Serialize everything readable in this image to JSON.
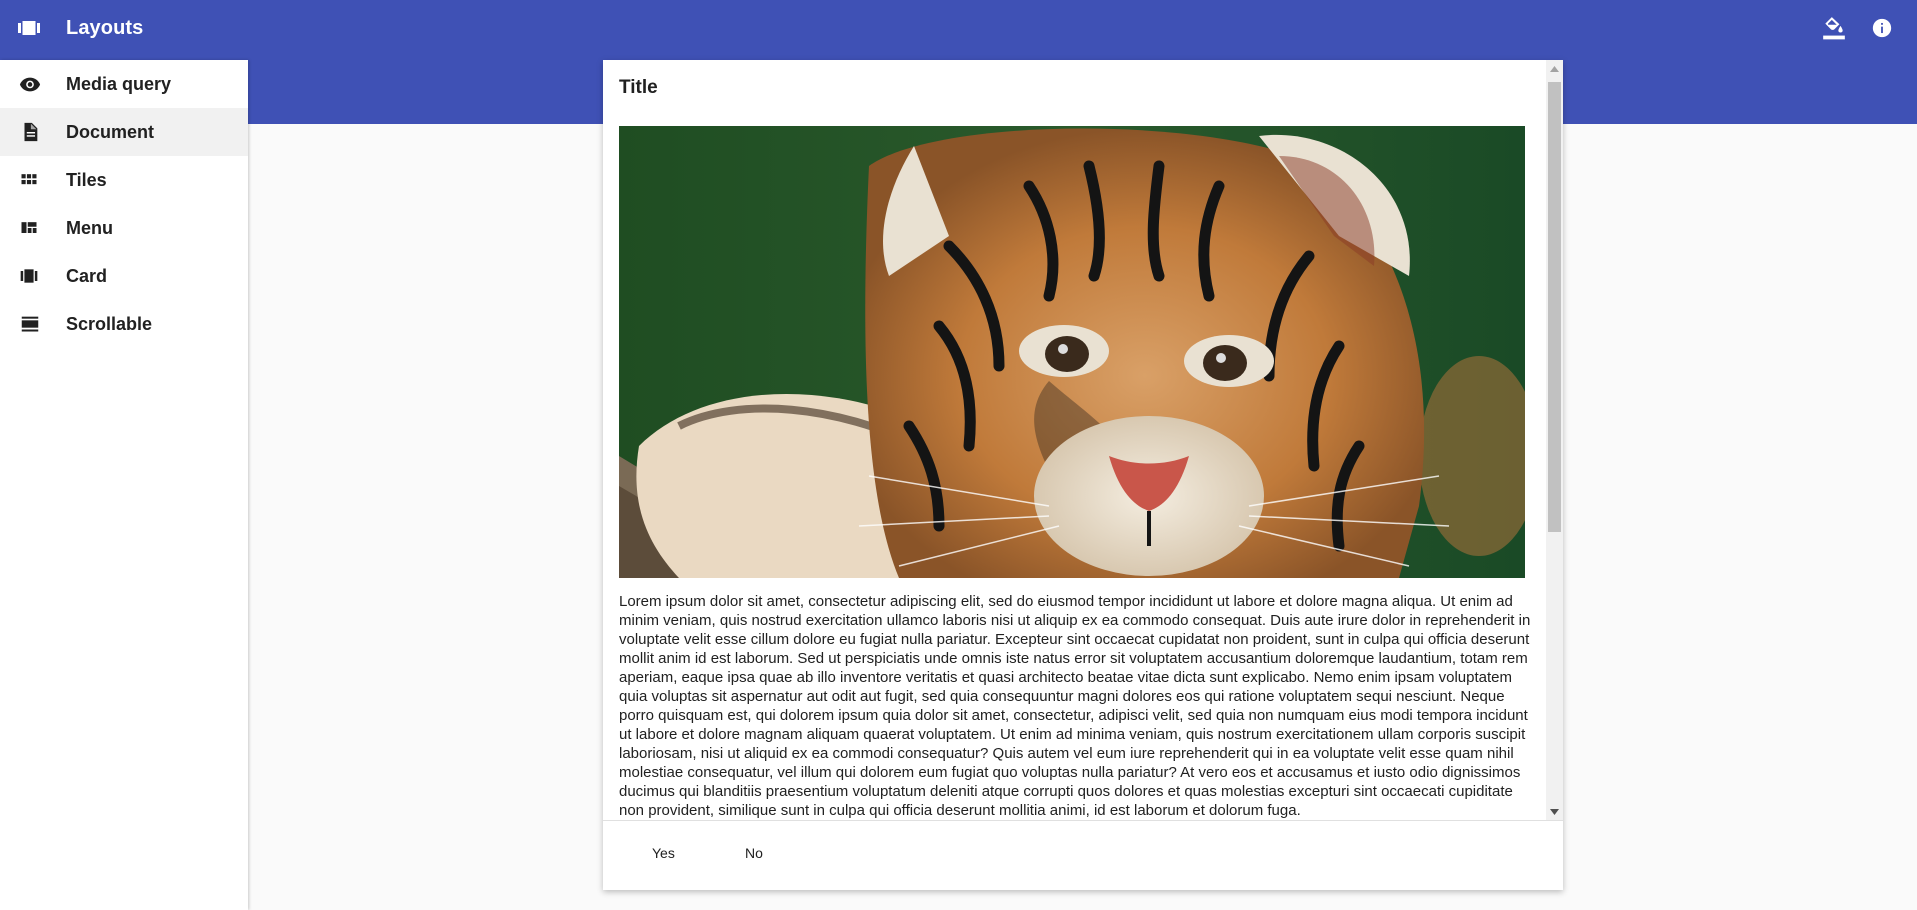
{
  "app": {
    "title": "Layouts"
  },
  "toolbar": {
    "actions": [
      {
        "icon": "paint-bucket-icon"
      },
      {
        "icon": "info-icon"
      }
    ]
  },
  "sidebar": {
    "items": [
      {
        "label": "Media query",
        "icon": "eye-icon",
        "active": false
      },
      {
        "label": "Document",
        "icon": "document-icon",
        "active": true
      },
      {
        "label": "Tiles",
        "icon": "grid-icon",
        "active": false
      },
      {
        "label": "Menu",
        "icon": "dashboard-icon",
        "active": false
      },
      {
        "label": "Card",
        "icon": "carousel-icon",
        "active": false
      },
      {
        "label": "Scrollable",
        "icon": "list-icon",
        "active": false
      }
    ]
  },
  "dialog": {
    "title": "Title",
    "image": {
      "subject": "tiger-cub-photo"
    },
    "body": "Lorem ipsum dolor sit amet, consectetur adipiscing elit, sed do eiusmod tempor incididunt ut labore et dolore magna aliqua. Ut enim ad minim veniam, quis nostrud exercitation ullamco laboris nisi ut aliquip ex ea commodo consequat. Duis aute irure dolor in reprehenderit in voluptate velit esse cillum dolore eu fugiat nulla pariatur. Excepteur sint occaecat cupidatat non proident, sunt in culpa qui officia deserunt mollit anim id est laborum. Sed ut perspiciatis unde omnis iste natus error sit voluptatem accusantium doloremque laudantium, totam rem aperiam, eaque ipsa quae ab illo inventore veritatis et quasi architecto beatae vitae dicta sunt explicabo. Nemo enim ipsam voluptatem quia voluptas sit aspernatur aut odit aut fugit, sed quia consequuntur magni dolores eos qui ratione voluptatem sequi nesciunt. Neque porro quisquam est, qui dolorem ipsum quia dolor sit amet, consectetur, adipisci velit, sed quia non numquam eius modi tempora incidunt ut labore et dolore magnam aliquam quaerat voluptatem. Ut enim ad minima veniam, quis nostrum exercitationem ullam corporis suscipit laboriosam, nisi ut aliquid ex ea commodi consequatur? Quis autem vel eum iure reprehenderit qui in ea voluptate velit esse quam nihil molestiae consequatur, vel illum qui dolorem eum fugiat quo voluptas nulla pariatur? At vero eos et accusamus et iusto odio dignissimos ducimus qui blanditiis praesentium voluptatum deleniti atque corrupti quos dolores et quas molestias excepturi sint occaecati cupiditate non provident, similique sunt in culpa qui officia deserunt mollitia animi, id est laborum et dolorum fuga.",
    "actions": {
      "yes": "Yes",
      "no": "No"
    }
  },
  "colors": {
    "primary": "#3f51b5",
    "background": "#fafafa",
    "sidebar_active": "#f1f1f1"
  }
}
